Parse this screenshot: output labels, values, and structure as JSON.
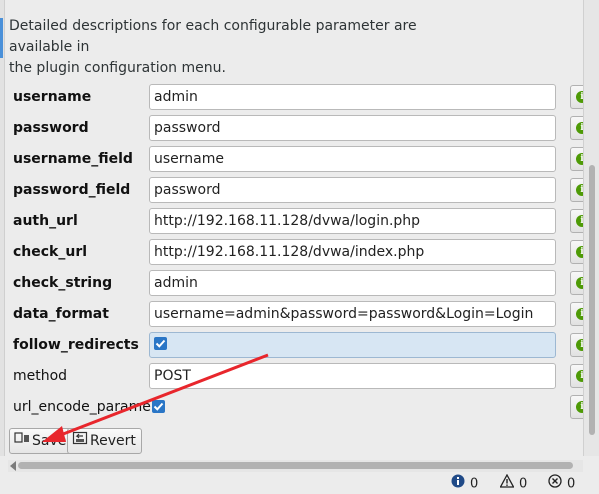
{
  "description": {
    "line1": "Detailed descriptions for each configurable parameter are available in",
    "line2": "the plugin configuration menu."
  },
  "params": [
    {
      "label": "username",
      "value": "admin",
      "bold": true,
      "type": "text"
    },
    {
      "label": "password",
      "value": "password",
      "bold": true,
      "type": "text"
    },
    {
      "label": "username_field",
      "value": "username",
      "bold": true,
      "type": "text"
    },
    {
      "label": "password_field",
      "value": "password",
      "bold": true,
      "type": "text"
    },
    {
      "label": "auth_url",
      "value": "http://192.168.11.128/dvwa/login.php",
      "bold": true,
      "type": "text"
    },
    {
      "label": "check_url",
      "value": "http://192.168.11.128/dvwa/index.php",
      "bold": true,
      "type": "text"
    },
    {
      "label": "check_string",
      "value": "admin",
      "bold": true,
      "type": "text"
    },
    {
      "label": "data_format",
      "value": "username=admin&password=password&Login=Login",
      "bold": true,
      "type": "text"
    },
    {
      "label": "follow_redirects",
      "checked": true,
      "bold": true,
      "type": "checkbox"
    },
    {
      "label": "method",
      "value": "POST",
      "bold": false,
      "type": "text"
    },
    {
      "label": "url_encode_parame",
      "checked": true,
      "bold": false,
      "type": "checkbox"
    }
  ],
  "buttons": {
    "save": "Save",
    "revert": "Revert"
  },
  "info_icon": "i",
  "status": {
    "info_count": "0",
    "warning_count": "0",
    "error_count": "0"
  },
  "colors": {
    "info_green": "#4e9a06",
    "checkbox_blue": "#2a76c6",
    "annotation_red": "#e8262c"
  }
}
